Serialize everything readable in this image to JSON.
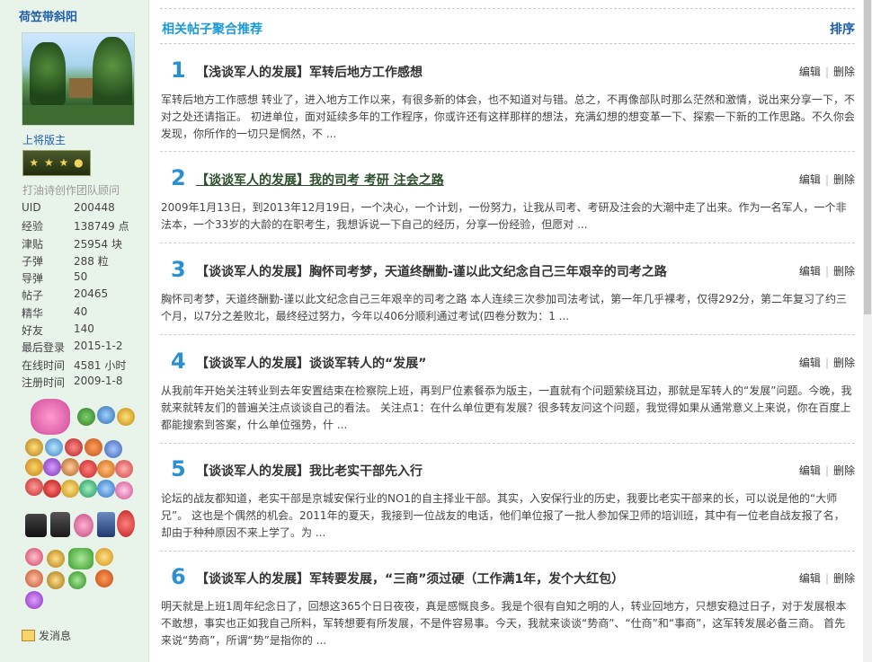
{
  "profile": {
    "username": "荷笠带斜阳",
    "rank_title": "上将版主",
    "rank_badge": "★ ★ ★ ●",
    "team": "打油诗创作团队顾问",
    "stats": [
      {
        "label": "UID",
        "value": "200448"
      },
      {
        "label": "经验",
        "value": "138749 点"
      },
      {
        "label": "津贴",
        "value": "25954 块"
      },
      {
        "label": "子弹",
        "value": "288 粒"
      },
      {
        "label": "导弹",
        "value": "50"
      },
      {
        "label": "帖子",
        "value": "20465"
      },
      {
        "label": "精华",
        "value": "40"
      },
      {
        "label": "好友",
        "value": "140"
      },
      {
        "label": "最后登录",
        "value": "2015-1-2"
      },
      {
        "label": "在线时间",
        "value": "4581 小时"
      },
      {
        "label": "注册时间",
        "value": "2009-1-8"
      }
    ],
    "send_message": "发消息"
  },
  "main": {
    "section_title": "相关帖子聚合推荐",
    "sort_label": "排序",
    "edit_label": "编辑",
    "delete_label": "删除",
    "posts": [
      {
        "num": "1",
        "title": "【浅谈军人的发展】军转后地方工作感想",
        "excerpt": "军转后地方工作感想 转业了，进入地方工作以来，有很多新的体会，也不知道对与错。总之，不再像部队时那么茫然和激情，说出来分享一下，不对之处还请指正。 初进单位，面对延续多年的工作程序，你或许还有这样那样的想法，充满幻想的想变革一下、探索一下新的工作思路。不久你会发现，你所作的一切只是惘然，不 ..."
      },
      {
        "num": "2",
        "title": "【谈谈军人的发展】我的司考 考研 注会之路",
        "excerpt": "2009年1月13日，到2013年12月19日，一个决心，一个计划，一份努力，让我从司考、考研及注会的大潮中走了出来。作为一名军人，一个非法本，一个33岁的大龄的在职考生，我想诉说一下自己的经历，分享一份经验，但愿对 ..."
      },
      {
        "num": "3",
        "title": "【谈谈军人的发展】胸怀司考梦，天道终酬勤-谨以此文纪念自己三年艰辛的司考之路",
        "excerpt": "胸怀司考梦，天道终酬勤-谨以此文纪念自己三年艰辛的司考之路 本人连续三次参加司法考试，第一年几乎裸考，仅得292分，第二年复习了约三个月，以7分之差败北，最终经过努力，今年以406分顺利通过考试(四卷分数为：1 ..."
      },
      {
        "num": "4",
        "title": "【谈谈军人的发展】谈谈军转人的“发展”",
        "excerpt": "从我前年开始关注转业到去年安置结束在检察院上班，再到尸位素餐忝为版主，一直就有个问题萦绕耳边，那就是军转人的“发展”问题。今晚，我就来就转友们的普遍关注点谈谈自己的看法。 关注点1：在什么单位更有发展？很多转友问这个问题，我觉得如果从通常意义上来说，你在百度上都能搜索到答案，什么单位强势，什 ..."
      },
      {
        "num": "5",
        "title": "【谈谈军人的发展】我比老实干部先入行",
        "excerpt": "论坛的战友都知道，老实干部是京城安保行业的NO1的自主择业干部。其实，入安保行业的历史，我要比老实干部来的长，可以说是他的“大师兄”。 这也是个偶然的机会。2011年的夏天，我接到一位战友的电话，他们单位报了一批人参加保卫师的培训班，其中有一位老自战友报了名，却由于种种原因不来上学了。为 ..."
      },
      {
        "num": "6",
        "title": "【谈谈军人的发展】军转要发展，“三商”须过硬（工作满1年，发个大红包）",
        "excerpt": "明天就是上班1周年纪念日了，回想这365个日日夜夜，真是感慨良多。我是个很有自知之明的人，转业回地方，只想安稳过日子，对于发展根本不敢想，事实也正如我自己所料，军转想要有所发展，不是件容易事。今天，我就来谈谈“势商”、“仕商”和“事商”，这军转发展必备三商。 首先来说“势商”，所谓“势”是指你的 ..."
      }
    ]
  }
}
